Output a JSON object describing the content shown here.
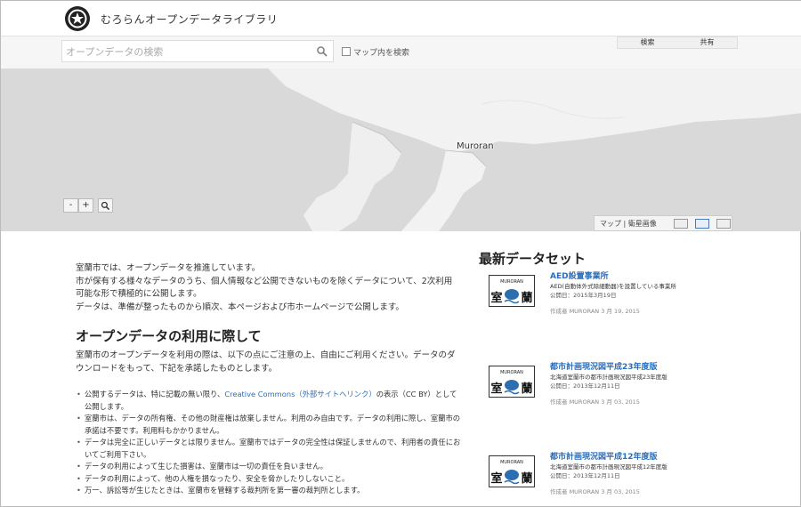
{
  "header": {
    "app_title": "むろらんオープンデータライブラリ"
  },
  "search": {
    "placeholder": "オープンデータの検索",
    "map_checkbox_label": "マップ内を検索"
  },
  "tabs": [
    {
      "label": "検索"
    },
    {
      "label": "共有"
    }
  ],
  "map": {
    "place_label": "Muroran",
    "zoom_in": "+",
    "zoom_out": "-",
    "layer_label": "マップ | 衛星画像"
  },
  "intro": [
    "室蘭市では、オープンデータを推進しています。",
    "市が保有する様々なデータのうち、個人情報など公開できないものを除くデータについて、2次利用可能な形で積極的に公開します。",
    "データは、準備が整ったものから順次、本ページおよび市ホームページで公開します。"
  ],
  "terms": {
    "title": "オープンデータの利用に際して",
    "intro": "室蘭市のオープンデータを利用の際は、以下の点にご注意の上、自由にご利用ください。データのダウンロードをもって、下記を承諾したものとします。",
    "items": [
      {
        "before": "公開するデータは、特に記載の無い限り、",
        "link": "Creative Commons（外部サイトへリンク）",
        "after": "の表示（CC BY）として公開します。"
      },
      {
        "text": "室蘭市は、データの所有権、その他の財産権は放棄しません。利用のみ自由です。データの利用に際し、室蘭市の承諾は不要です。利用料もかかりません。"
      },
      {
        "text": "データは完全に正しいデータとは限りません。室蘭市ではデータの完全性は保証しませんので、利用者の責任においてご利用下さい。"
      },
      {
        "text": "データの利用によって生じた損害は、室蘭市は一切の責任を負いません。"
      },
      {
        "text": "データの利用によって、他の人権を損なったり、安全を脅かしたりしないこと。"
      },
      {
        "text": "万一、訴訟等が生じたときは、室蘭市を管轄する裁判所を第一審の裁判所とします。"
      }
    ]
  },
  "datasets": {
    "title": "最新データセット",
    "thumb_text": {
      "top": "MURORAN",
      "left": "室",
      "right": "蘭"
    },
    "items": [
      {
        "title": "AED設置事業所",
        "desc": "AED(自動体外式除細動器)を設置している事業所",
        "date": "公開日：2015年3月19日",
        "author": "作成者 MURORAN 3 月 19, 2015"
      },
      {
        "title": "都市計画現況図平成23年度版",
        "desc": "北海道室蘭市の都市計画現況図平成23年度版",
        "date": "公開日：2013年12月11日",
        "author": "作成者 MURORAN 3 月 03, 2015"
      },
      {
        "title": "都市計画現況図平成12年度版",
        "desc": "北海道室蘭市の都市計画現況図平成12年度版",
        "date": "公開日：2013年12月11日",
        "author": "作成者 MURORAN 3 月 03, 2015"
      }
    ]
  },
  "colors": {
    "link": "#2a6ebb",
    "map_land": "#f2f2f2",
    "map_water": "#d9d9d9"
  }
}
